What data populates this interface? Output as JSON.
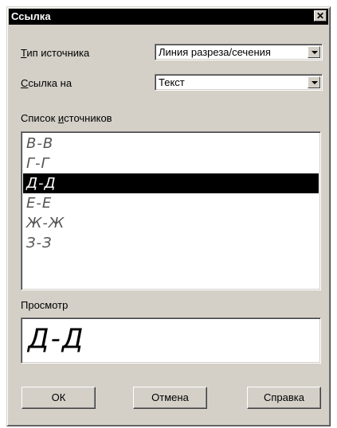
{
  "dialog": {
    "title": "Ссылка",
    "close_glyph": "✕"
  },
  "source_type": {
    "label_mnemonic": "Т",
    "label_rest": "ип источника",
    "value": "Линия разреза/сечения"
  },
  "link_to": {
    "label_mnemonic": "С",
    "label_rest": "сылка на",
    "value": "Текст"
  },
  "source_list": {
    "label_before": "Список ",
    "label_mnemonic": "и",
    "label_rest": "сточников",
    "items": [
      "В-В",
      "Г-Г",
      "Д-Д",
      "Е-Е",
      "Ж-Ж",
      "З-З"
    ],
    "selected": "Д-Д"
  },
  "preview": {
    "label": "Просмотр",
    "value": "Д-Д"
  },
  "buttons": {
    "ok": "ОК",
    "cancel": "Отмена",
    "help": "Справка"
  },
  "colors": {
    "titlebar": "#000000",
    "dialog_face": "#d4d0c8",
    "selection": "#000000"
  }
}
